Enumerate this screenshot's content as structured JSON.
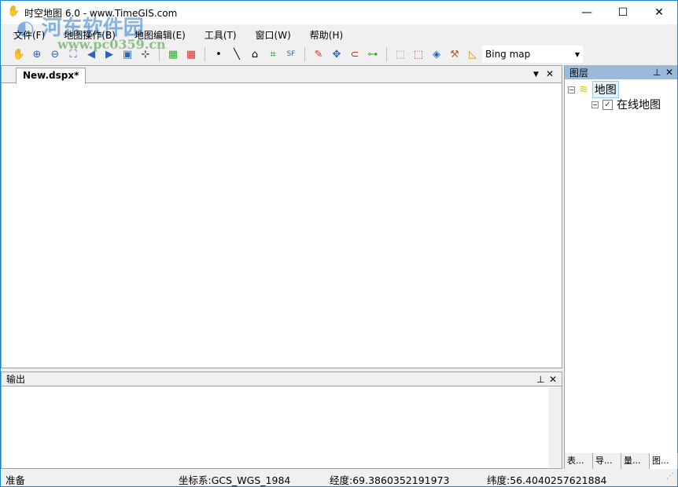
{
  "window": {
    "title": "时空地图 6.0 - www.TimeGIS.com",
    "minimize": "—",
    "maximize": "☐",
    "close": "✕"
  },
  "watermark": {
    "name": "河东软件园",
    "url": "www.pc0359.cn"
  },
  "menu": [
    "文件(F)",
    "地图操作(B)",
    "地图编辑(E)",
    "工具(T)",
    "窗口(W)",
    "帮助(H)"
  ],
  "toolbar": {
    "icons": [
      "pan-hand",
      "zoom-in",
      "zoom-out",
      "full-extent",
      "back",
      "forward",
      "zoom-box",
      "crosshair",
      "add-layer",
      "remove-layer",
      "point",
      "line",
      "polygon",
      "add-vertex",
      "shapefile",
      "edit-pencil",
      "move",
      "magnet",
      "connect",
      "select-box",
      "clear-selection",
      "info",
      "hammer",
      "ruler",
      "table"
    ],
    "basemap": "Bing map"
  },
  "document": {
    "tab": "New.dspx*"
  },
  "layers": {
    "title": "图层",
    "root": "地图",
    "child": "在线地图",
    "child_checked": true,
    "tabs": [
      "表...",
      "导...",
      "量...",
      "图..."
    ]
  },
  "output": {
    "title": "输出"
  },
  "status": {
    "ready": "准备",
    "crs": "坐标系:GCS_WGS_1984",
    "lon": "经度:69.3860352191973",
    "lat": "纬度:56.4040257621884"
  }
}
